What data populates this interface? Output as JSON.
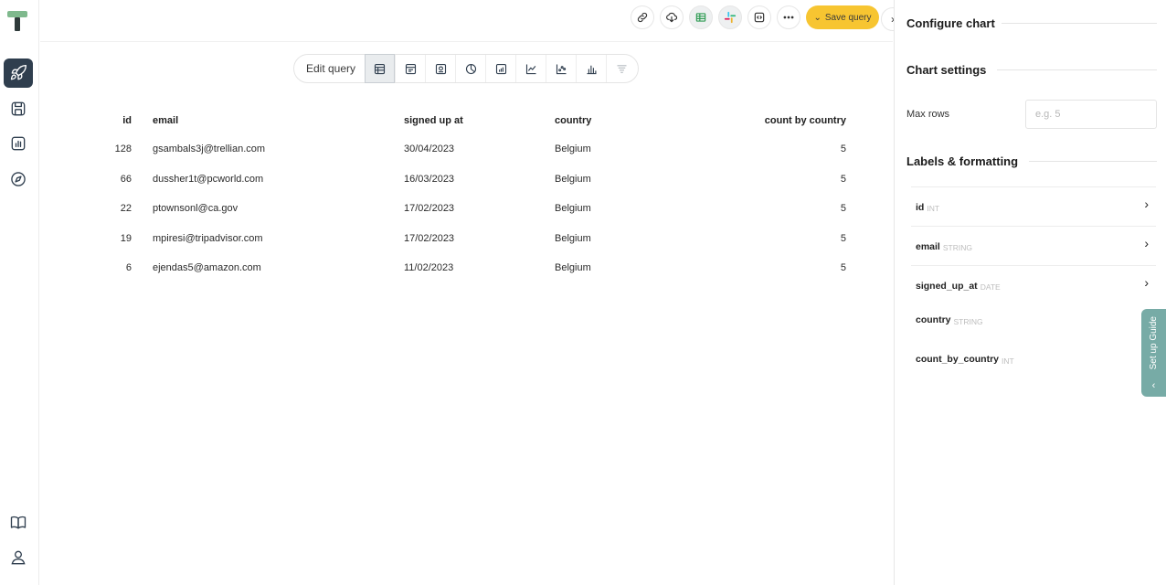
{
  "sidebar": {
    "items": [
      {
        "name": "rocket",
        "active": true
      },
      {
        "name": "saved"
      },
      {
        "name": "dashboards"
      },
      {
        "name": "explore"
      }
    ],
    "bottom": [
      {
        "name": "docs"
      },
      {
        "name": "profile"
      }
    ]
  },
  "toolbar": {
    "save_label": "Save query",
    "icons": [
      "link-icon",
      "cloud-download-icon",
      "google-sheets-icon",
      "slack-icon",
      "embed-code-icon",
      "more-icon"
    ]
  },
  "viz": {
    "edit_label": "Edit query",
    "options": [
      "table",
      "card",
      "big-number",
      "pie",
      "bar-line",
      "line",
      "scatter",
      "bar",
      "funnel"
    ],
    "active": "table"
  },
  "table": {
    "columns": [
      "id",
      "email",
      "signed up at",
      "country",
      "count by country"
    ],
    "rows": [
      [
        "128",
        "gsambals3j@trellian.com",
        "30/04/2023",
        "Belgium",
        "5"
      ],
      [
        "66",
        "dussher1t@pcworld.com",
        "16/03/2023",
        "Belgium",
        "5"
      ],
      [
        "22",
        "ptownsonl@ca.gov",
        "17/02/2023",
        "Belgium",
        "5"
      ],
      [
        "19",
        "mpiresi@tripadvisor.com",
        "17/02/2023",
        "Belgium",
        "5"
      ],
      [
        "6",
        "ejendas5@amazon.com",
        "11/02/2023",
        "Belgium",
        "5"
      ]
    ]
  },
  "panel": {
    "title": "Configure chart",
    "chart_settings": "Chart settings",
    "max_rows_label": "Max rows",
    "max_rows_placeholder": "e.g. 5",
    "labels_formatting": "Labels & formatting",
    "fields": [
      {
        "name": "id",
        "type": "INT",
        "expandable": true
      },
      {
        "name": "email",
        "type": "STRING",
        "expandable": true
      },
      {
        "name": "signed_up_at",
        "type": "DATE",
        "expandable": true
      },
      {
        "name": "country",
        "type": "STRING",
        "expandable": false
      },
      {
        "name": "count_by_country",
        "type": "INT",
        "expandable": false
      }
    ]
  },
  "setup_guide": "Set up Guide",
  "colors": {
    "accent": "#f7c531",
    "nav_active": "#2f3e4e",
    "guide": "#77aba6",
    "logo_green": "#7fb98d"
  }
}
